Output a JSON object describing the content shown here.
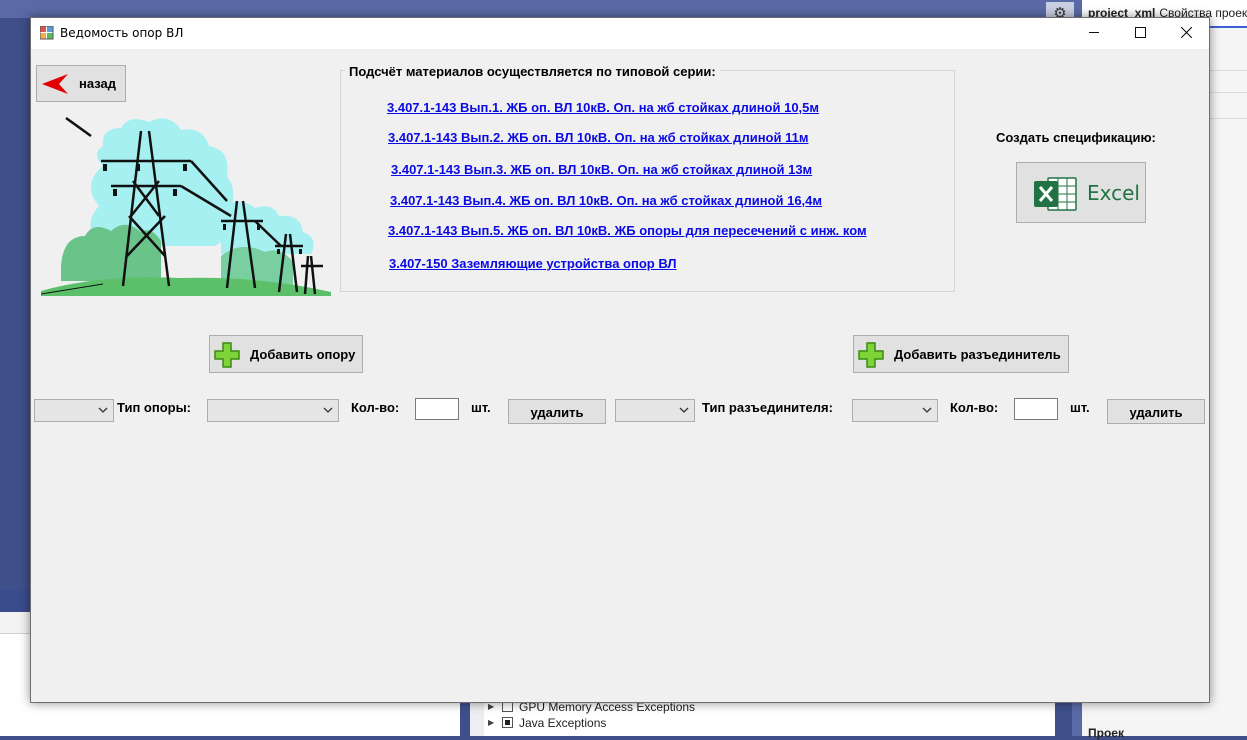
{
  "background": {
    "right_panel_title_bold": "project_xml",
    "right_panel_title": "Свойства проек",
    "right_panel_bottom": "Проек",
    "exceptions": [
      {
        "label": "GPU Memory Access Exceptions",
        "checked": false
      },
      {
        "label": "Java Exceptions",
        "checked": true
      }
    ]
  },
  "window": {
    "title": "Ведомость опор ВЛ",
    "back_label": "назад",
    "series_title": "Подсчёт материалов осуществляется по типовой серии:",
    "series": [
      "3.407.1-143 Вып.1. ЖБ оп. ВЛ 10кВ. Оп. на жб стойках длиной 10,5м",
      "3.407.1-143 Вып.2. ЖБ оп. ВЛ 10кВ. Оп. на жб стойках длиной 11м",
      "3.407.1-143 Вып.3. ЖБ оп. ВЛ 10кВ. Оп. на жб стойках длиной 13м",
      "3.407.1-143 Вып.4. ЖБ оп. ВЛ 10кВ. Оп. на жб стойках длиной 16,4м",
      "3.407.1-143 Вып.5. ЖБ оп. ВЛ 10кВ. ЖБ опоры для пересечений с инж. ком",
      "3.407-150 Заземляющие устройства опор ВЛ"
    ],
    "spec_label": "Создать спецификацию:",
    "excel_label": "Excel",
    "add_pole_label": "Добавить опору",
    "add_disconnector_label": "Добавить разъединитель",
    "pole_row": {
      "type_label": "Тип опоры:",
      "qty_label": "Кол-во:",
      "unit": "шт.",
      "qty_value": "",
      "delete_label": "удалить"
    },
    "disc_row": {
      "type_label": "Тип разъединителя:",
      "qty_label": "Кол-во:",
      "unit": "шт.",
      "qty_value": "",
      "delete_label": "удалить"
    }
  },
  "colors": {
    "link": "#0a0ae6",
    "excel_green": "#217346",
    "window_bg": "#f0f0f0"
  }
}
